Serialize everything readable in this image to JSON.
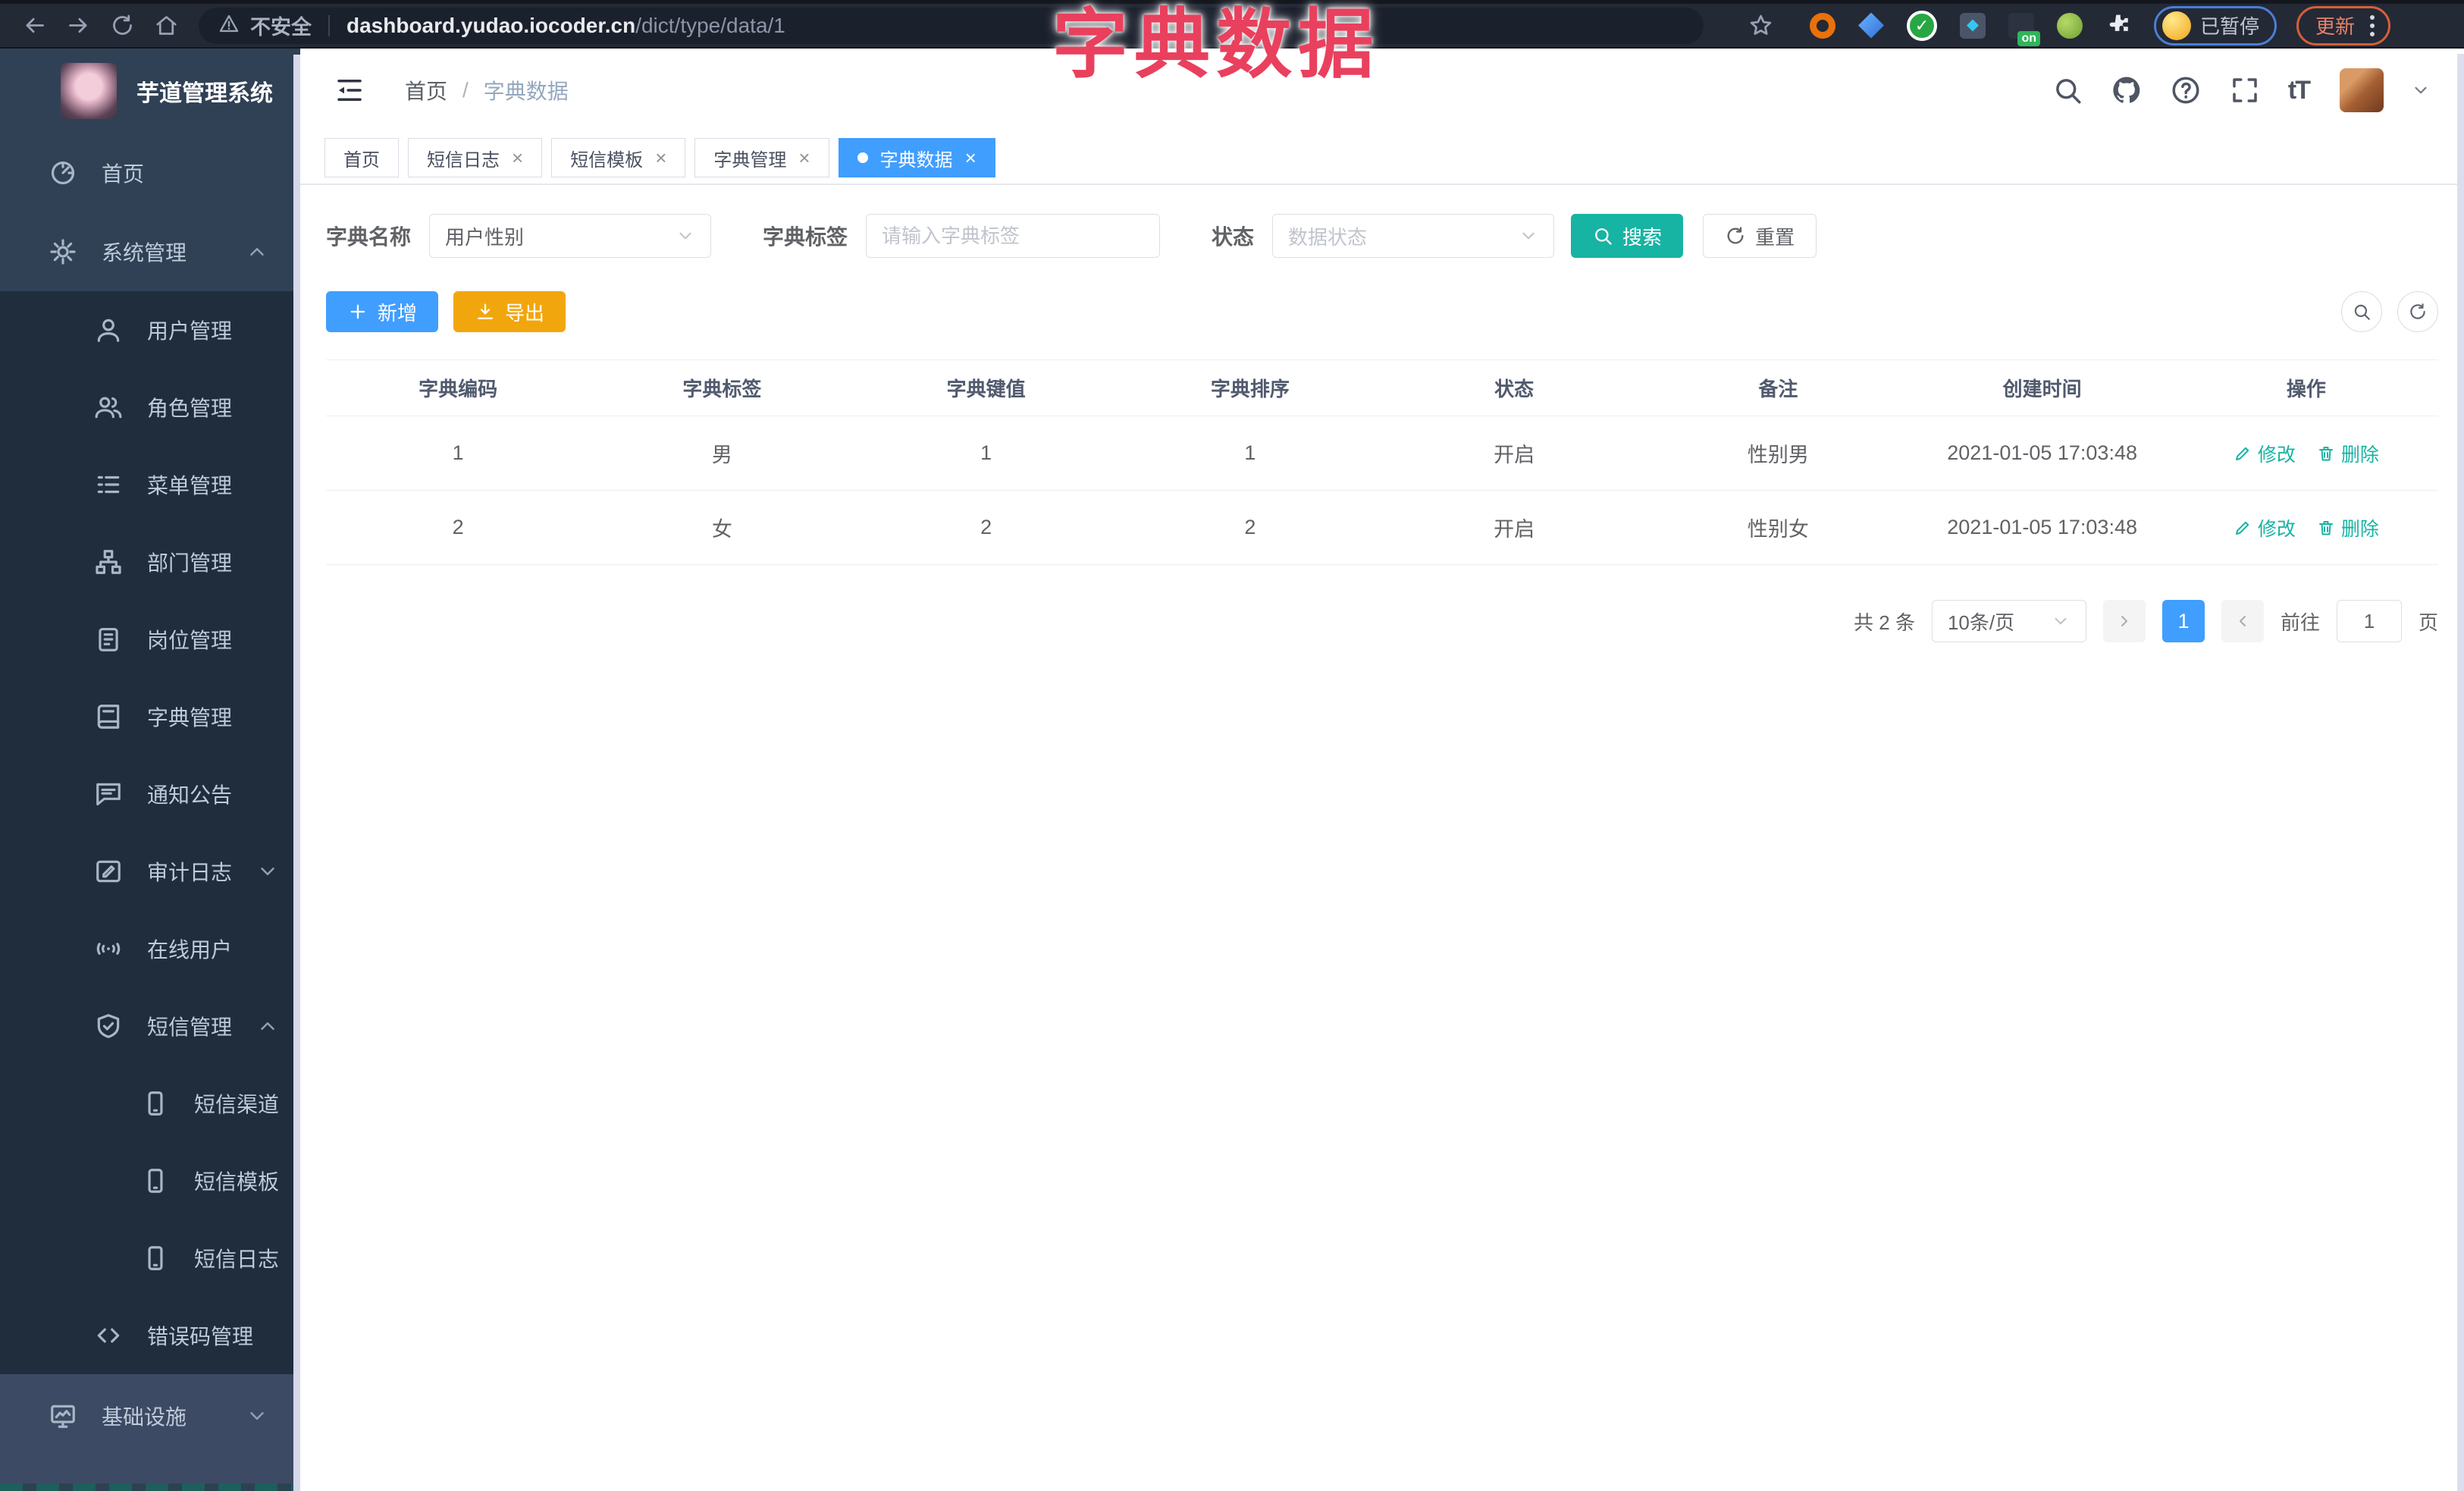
{
  "browser": {
    "security_label": "不安全",
    "url_host": "dashboard.yudao.iocoder.cn",
    "url_path": "/dict/type/data/1",
    "ext_on_badge": "on",
    "paused_label": "已暂停",
    "update_label": "更新"
  },
  "overlay_title": "字典数据",
  "sidebar": {
    "logo_title": "芋道管理系统",
    "items": [
      {
        "label": "首页"
      },
      {
        "label": "系统管理"
      },
      {
        "label": "用户管理"
      },
      {
        "label": "角色管理"
      },
      {
        "label": "菜单管理"
      },
      {
        "label": "部门管理"
      },
      {
        "label": "岗位管理"
      },
      {
        "label": "字典管理"
      },
      {
        "label": "通知公告"
      },
      {
        "label": "审计日志"
      },
      {
        "label": "在线用户"
      },
      {
        "label": "短信管理"
      },
      {
        "label": "短信渠道"
      },
      {
        "label": "短信模板"
      },
      {
        "label": "短信日志"
      },
      {
        "label": "错误码管理"
      },
      {
        "label": "基础设施"
      }
    ]
  },
  "header": {
    "breadcrumb": {
      "home": "首页",
      "sep": "/",
      "current": "字典数据"
    },
    "font_icon": "tT"
  },
  "tabs": [
    {
      "label": "首页"
    },
    {
      "label": "短信日志"
    },
    {
      "label": "短信模板"
    },
    {
      "label": "字典管理"
    },
    {
      "label": "字典数据"
    }
  ],
  "filters": {
    "name_label": "字典名称",
    "name_value": "用户性别",
    "tag_label": "字典标签",
    "tag_placeholder": "请输入字典标签",
    "status_label": "状态",
    "status_placeholder": "数据状态",
    "search_label": "搜索",
    "reset_label": "重置"
  },
  "toolbar": {
    "add_label": "新增",
    "export_label": "导出"
  },
  "table": {
    "headers": [
      "字典编码",
      "字典标签",
      "字典键值",
      "字典排序",
      "状态",
      "备注",
      "创建时间",
      "操作"
    ],
    "rows": [
      {
        "code": "1",
        "label": "男",
        "value": "1",
        "sort": "1",
        "status": "开启",
        "remark": "性别男",
        "created": "2021-01-05 17:03:48"
      },
      {
        "code": "2",
        "label": "女",
        "value": "2",
        "sort": "2",
        "status": "开启",
        "remark": "性别女",
        "created": "2021-01-05 17:03:48"
      }
    ],
    "edit_label": "修改",
    "delete_label": "删除"
  },
  "pagination": {
    "total_label": "共 2 条",
    "size_label": "10条/页",
    "page": "1",
    "goto_label": "前往",
    "goto_value": "1",
    "unit_label": "页"
  },
  "colors": {
    "accent_blue": "#409eff",
    "theme_teal": "#17b3a3",
    "warning_orange": "#f2a60d",
    "overlay_red": "#e9405e",
    "sidebar_bg": "#304156",
    "submenu_bg": "#1f2d3d"
  }
}
